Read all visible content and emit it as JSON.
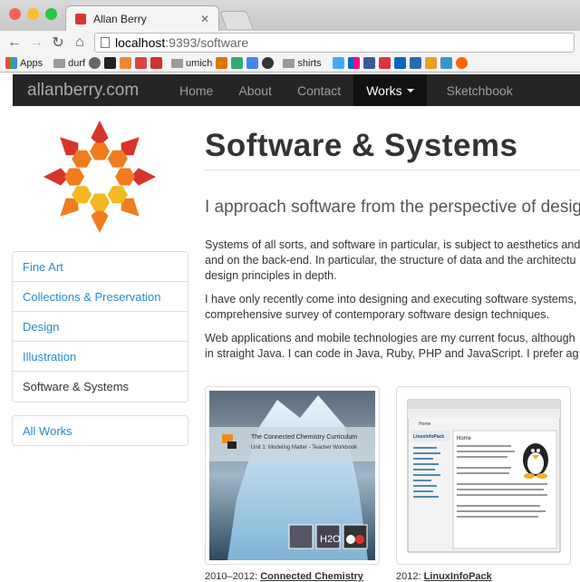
{
  "browser": {
    "tab_title": "Allan Berry",
    "url_host": "localhost",
    "url_rest": ":9393/software",
    "bookmarks": [
      "Apps",
      "durf",
      "umich",
      "shirts"
    ]
  },
  "site": {
    "brand": "allanberry.com",
    "nav": [
      "Home",
      "About",
      "Contact",
      "Works",
      "Sketchbook"
    ]
  },
  "sidebar": {
    "items": [
      {
        "label": "Fine Art"
      },
      {
        "label": "Collections & Preservation"
      },
      {
        "label": "Design"
      },
      {
        "label": "Illustration"
      },
      {
        "label": "Software & Systems"
      }
    ],
    "all_works": "All Works"
  },
  "content": {
    "title": "Software & Systems",
    "lead": "I approach software from the perspective of design.",
    "paragraphs": [
      "Systems of all sorts, and software in particular, is subject to aesthetics and",
      "and on the back-end. In particular, the structure of data and the architectu",
      "design principles in depth.",
      "I have only recently come into designing and executing software systems,",
      "comprehensive survey of contemporary software design techniques.",
      "Web applications and mobile technologies are my current focus, although",
      "in straight Java. I can code in Java, Ruby, PHP and JavaScript. I prefer ag"
    ],
    "works": [
      {
        "year": "2010–2012:",
        "name": "Connected Chemistry",
        "cover_title": "The Connected Chemistry Curriculum",
        "cover_sub": "Unit 1: Modeling Matter - Teacher Workbook",
        "h2o": "H2O"
      },
      {
        "year": "2012:",
        "name": "LinuxInfoPack",
        "wiki_heading": "LinuxInfoPack",
        "wiki_page": "Home"
      }
    ]
  },
  "colors": {
    "nav_bg": "#252525",
    "link": "#2a8ad0",
    "logo_red": "#d9342b",
    "logo_orange": "#f07c1f",
    "logo_yellow": "#f5b820"
  }
}
